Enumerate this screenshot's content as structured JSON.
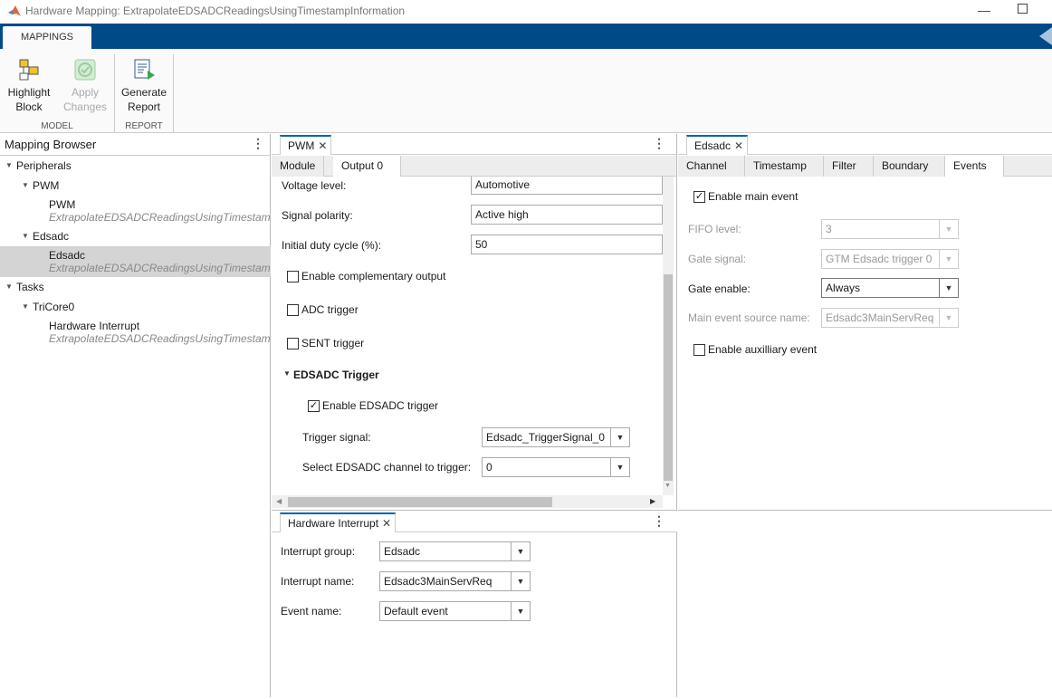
{
  "window": {
    "title": "Hardware Mapping: ExtrapolateEDSADCReadingsUsingTimestampInformation"
  },
  "tabstrip": {
    "active_tab": "MAPPINGS"
  },
  "ribbon": {
    "highlight_block": [
      "Highlight",
      "Block"
    ],
    "apply_changes": [
      "Apply",
      "Changes"
    ],
    "generate_report": [
      "Generate",
      "Report"
    ],
    "group_model": "MODEL",
    "group_report": "REPORT"
  },
  "browser": {
    "title": "Mapping Browser",
    "peripherals": "Peripherals",
    "pwm": "PWM",
    "pwm_item": "PWM",
    "pwm_item_sub": "ExtrapolateEDSADCReadingsUsingTimestam",
    "edsadc": "Edsadc",
    "edsadc_item": "Edsadc",
    "edsadc_item_sub": "ExtrapolateEDSADCReadingsUsingTimestam",
    "tasks": "Tasks",
    "tricore": "TriCore0",
    "hwi_item": "Hardware Interrupt",
    "hwi_item_sub": "ExtrapolateEDSADCReadingsUsingTimestam"
  },
  "pwm_panel": {
    "tab": "PWM",
    "subtabs": [
      "Module",
      "Output 0"
    ],
    "voltage_level_label": "Voltage level:",
    "voltage_level_value": "Automotive",
    "signal_polarity_label": "Signal polarity:",
    "signal_polarity_value": "Active high",
    "initial_duty_label": "Initial duty cycle (%):",
    "initial_duty_value": "50",
    "enable_complementary": "Enable complementary output",
    "adc_trigger": "ADC trigger",
    "sent_trigger": "SENT trigger",
    "edsadc_section": "EDSADC Trigger",
    "enable_edsadc_trigger": "Enable EDSADC trigger",
    "trigger_signal_label": "Trigger signal:",
    "trigger_signal_value": "Edsadc_TriggerSignal_0",
    "select_channel_label": "Select EDSADC channel to trigger:",
    "select_channel_value": "0"
  },
  "edsadc_panel": {
    "tab": "Edsadc",
    "subtabs": [
      "Channel",
      "Timestamp",
      "Filter",
      "Boundary",
      "Events"
    ],
    "enable_main_event": "Enable main event",
    "fifo_level_label": "FIFO level:",
    "fifo_level_value": "3",
    "gate_signal_label": "Gate signal:",
    "gate_signal_value": "GTM Edsadc trigger 0",
    "gate_enable_label": "Gate enable:",
    "gate_enable_value": "Always",
    "main_event_source_label": "Main event source name:",
    "main_event_source_value": "Edsadc3MainServReq",
    "enable_aux_event": "Enable auxilliary event"
  },
  "hwi_panel": {
    "tab": "Hardware Interrupt",
    "interrupt_group_label": "Interrupt group:",
    "interrupt_group_value": "Edsadc",
    "interrupt_name_label": "Interrupt name:",
    "interrupt_name_value": "Edsadc3MainServReq",
    "event_name_label": "Event name:",
    "event_name_value": "Default event"
  },
  "colors": {
    "accent": "#004a87",
    "selection": "#d4d4d4"
  }
}
